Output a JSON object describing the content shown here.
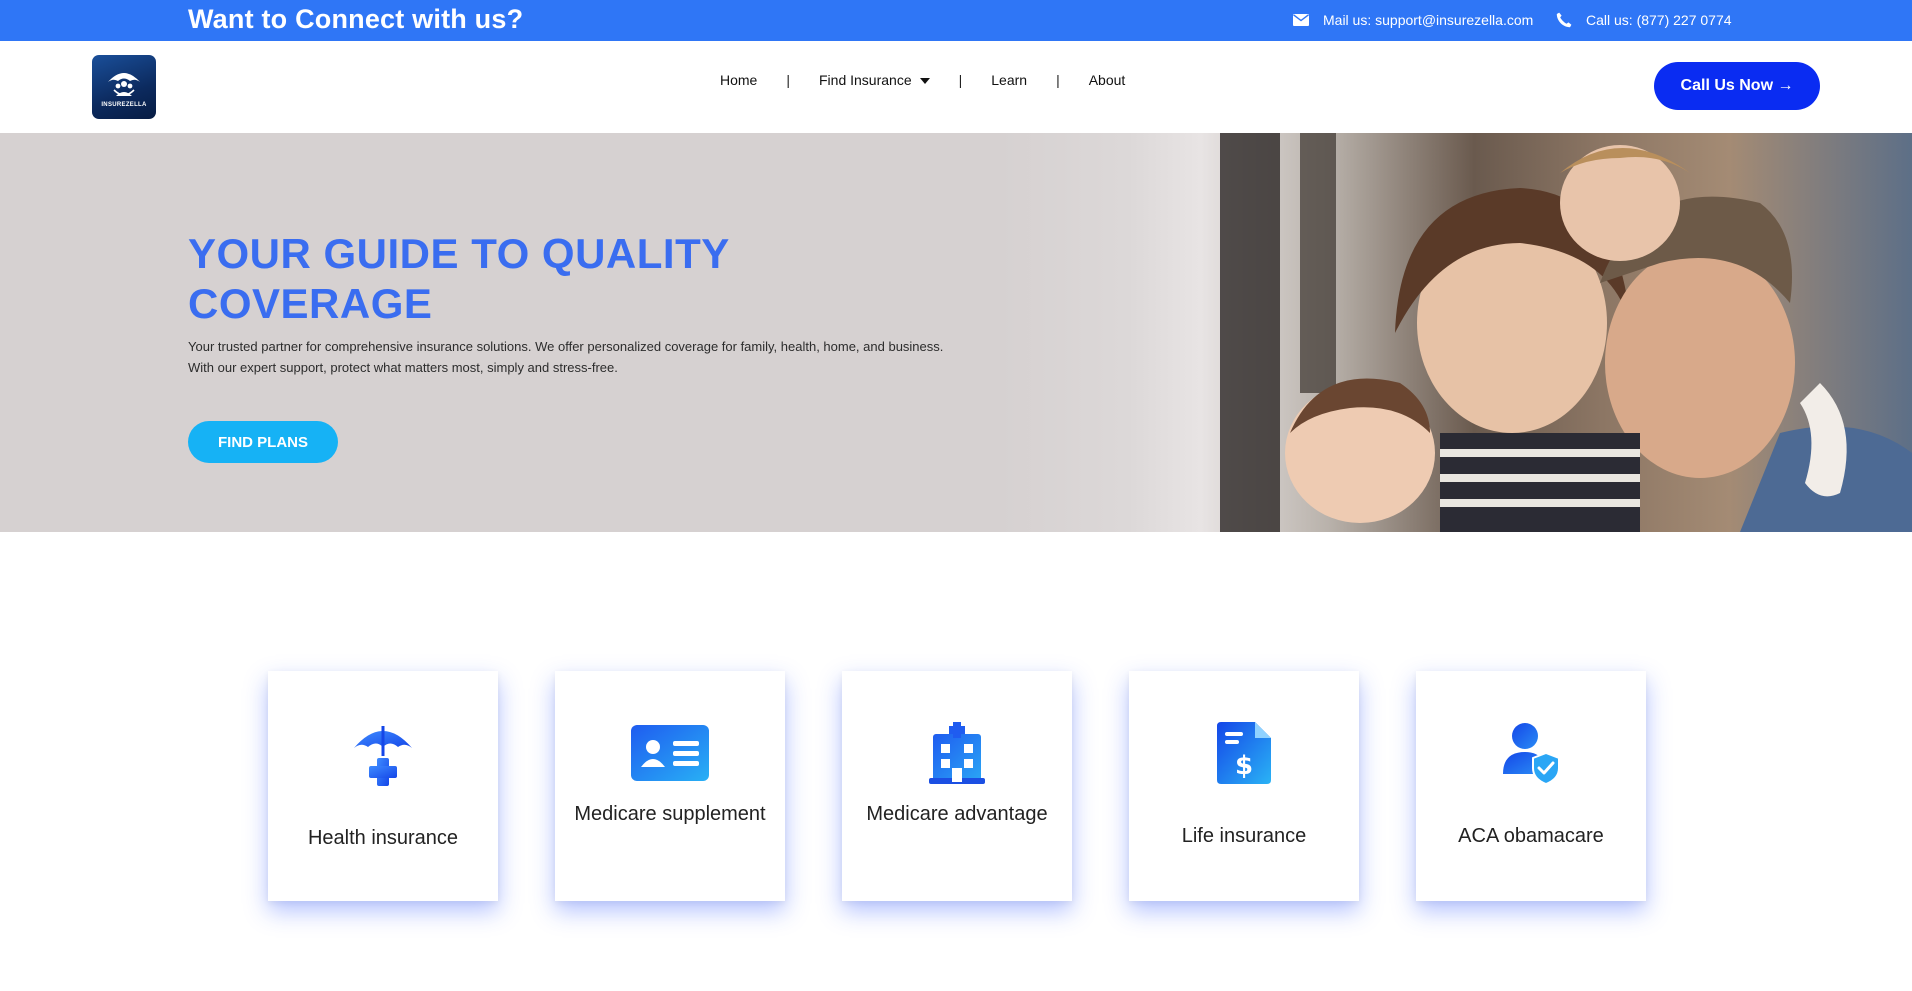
{
  "topbar": {
    "tagline": "Want to Connect with us?",
    "mail": "Mail us: support@insurezella.com",
    "phone": "Call us: (877) 227 0774",
    "mail_icon": "mail-icon",
    "phone_icon": "phone-icon"
  },
  "navbar": {
    "logo_text": "INSUREZELLA",
    "items": [
      {
        "label": "Home"
      },
      {
        "label": "Find Insurance",
        "has_dropdown": true
      },
      {
        "label": "Learn"
      },
      {
        "label": "About"
      }
    ],
    "separator": "|",
    "cta": "Call Us Now →"
  },
  "hero": {
    "title": "YOUR GUIDE TO QUALITY COVERAGE",
    "description": "Your trusted partner for comprehensive insurance solutions. We offer personalized coverage for family, health, home, and business. With our expert support, protect what matters most, simply and stress-free.",
    "button": "FIND PLANS"
  },
  "cards": [
    {
      "label": "Health insurance",
      "icon": "umbrella-medical-icon"
    },
    {
      "label": "Medicare supplement",
      "icon": "id-card-icon"
    },
    {
      "label": "Medicare advantage",
      "icon": "hospital-icon"
    },
    {
      "label": "Life insurance",
      "icon": "invoice-dollar-icon"
    },
    {
      "label": "ACA obamacare",
      "icon": "user-shield-icon"
    }
  ],
  "colors": {
    "topbar": "#2f76f6",
    "cta": "#0a2cf2",
    "hero_title": "#3a6df0",
    "find_plans": "#16b2f5",
    "hero_bg": "#d6d1d1"
  }
}
